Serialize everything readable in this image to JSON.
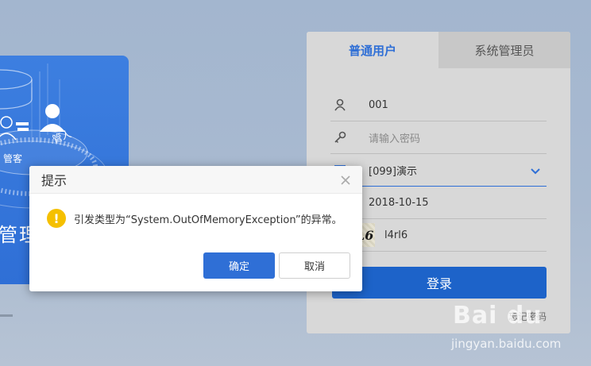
{
  "banner": {
    "label_1": "管客",
    "label_2": "管人",
    "text": "管理"
  },
  "login": {
    "tabs": [
      {
        "label": "普通用户",
        "active": true
      },
      {
        "label": "系统管理员",
        "active": false
      }
    ],
    "username": {
      "value": "001",
      "icon": "user-icon"
    },
    "password": {
      "placeholder": "请输入密码",
      "icon": "key-icon"
    },
    "account_set": {
      "value": "[099]演示",
      "icon": "list-icon"
    },
    "date": {
      "value": "2018-10-15",
      "icon": "calendar-icon"
    },
    "captcha": {
      "image_text": "l4RL6",
      "value": "l4rl6"
    },
    "submit_label": "登录",
    "forgot_label": "忘记密码"
  },
  "dialog": {
    "title": "提示",
    "message": "引发类型为“System.OutOfMemoryException”的异常。",
    "icon": "warning-icon",
    "ok_label": "确定",
    "cancel_label": "取消"
  },
  "watermark": {
    "logo": "Bai du",
    "sub": "jingyan.baidu.com"
  },
  "colors": {
    "accent": "#2f6fd6",
    "primary_button": "#1d63c9",
    "warning": "#f5c000",
    "panel_bg": "#d8d8d8"
  }
}
